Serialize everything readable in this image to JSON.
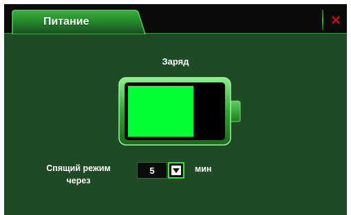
{
  "window": {
    "tab_title": "Питание",
    "close_icon": "close-icon",
    "accent_color": "#3ee03e",
    "close_color": "#e01010"
  },
  "battery": {
    "label": "Заряд",
    "level_percent": 70,
    "fill_color": "#00ff33"
  },
  "sleep": {
    "label_line1": "Спящий режим",
    "label_line2": "через",
    "value": "5",
    "dropdown_icon": "chevron-down-icon",
    "unit": "мин"
  }
}
